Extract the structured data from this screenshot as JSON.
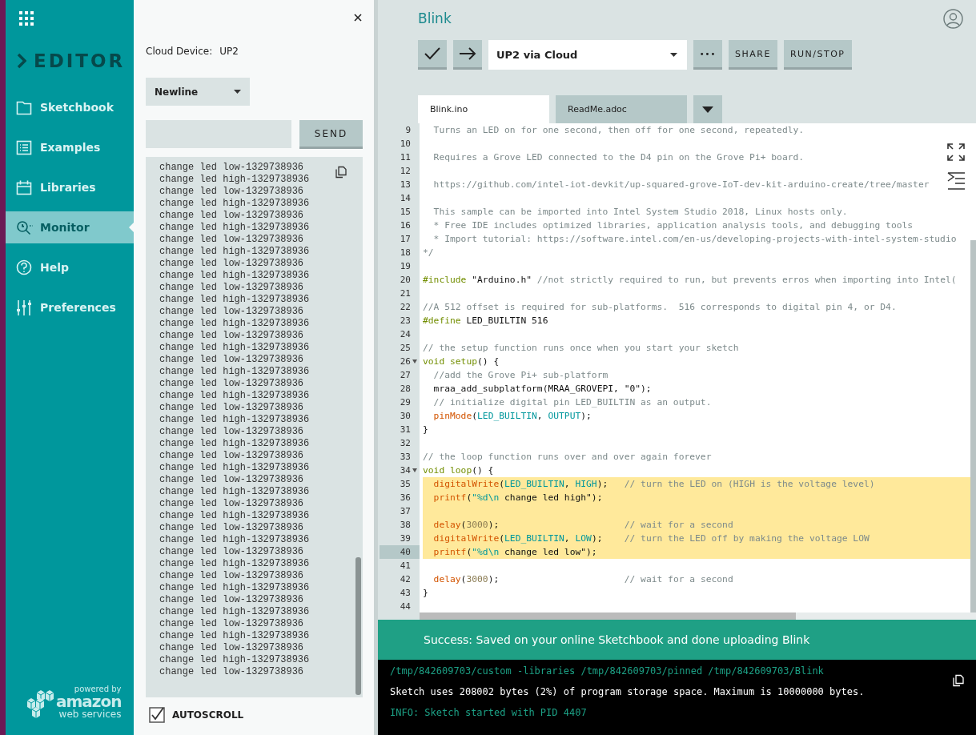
{
  "sidebar": {
    "logo": "EDITOR",
    "items": [
      {
        "label": "Sketchbook",
        "selected": false
      },
      {
        "label": "Examples",
        "selected": false
      },
      {
        "label": "Libraries",
        "selected": false
      },
      {
        "label": "Monitor",
        "selected": true
      },
      {
        "label": "Help",
        "selected": false
      },
      {
        "label": "Preferences",
        "selected": false
      }
    ],
    "footer": {
      "line_1": "powered by",
      "line_2": "amazon",
      "line_3": "web services"
    }
  },
  "monitor": {
    "device_label": "Cloud Device:",
    "device": "UP2",
    "line_ending": "Newline",
    "send_button": "SEND",
    "autoscroll": {
      "label": "AUTOSCROLL",
      "checked": true
    },
    "output": [
      "change led low-1329738936",
      "change led high-1329738936",
      "change led low-1329738936",
      "change led high-1329738936",
      "change led low-1329738936",
      "change led high-1329738936",
      "change led low-1329738936",
      "change led high-1329738936",
      "change led low-1329738936",
      "change led high-1329738936",
      "change led low-1329738936",
      "change led high-1329738936",
      "change led low-1329738936",
      "change led high-1329738936",
      "change led low-1329738936",
      "change led high-1329738936",
      "change led low-1329738936",
      "change led high-1329738936",
      "change led low-1329738936",
      "change led high-1329738936",
      "change led low-1329738936",
      "change led high-1329738936",
      "change led low-1329738936",
      "change led high-1329738936",
      "change led low-1329738936",
      "change led high-1329738936",
      "change led low-1329738936",
      "change led high-1329738936",
      "change led low-1329738936",
      "change led high-1329738936",
      "change led low-1329738936",
      "change led high-1329738936",
      "change led low-1329738936",
      "change led high-1329738936",
      "change led low-1329738936",
      "change led high-1329738936",
      "change led low-1329738936",
      "change led high-1329738936",
      "change led low-1329738936",
      "change led high-1329738936",
      "change led low-1329738936",
      "change led high-1329738936",
      "change led low-1329738936"
    ]
  },
  "header": {
    "title": "Blink",
    "board": "UP2 via Cloud",
    "buttons": [
      "SHARE",
      "RUN/STOP"
    ],
    "more": "•••"
  },
  "tabs": [
    {
      "label": "Blink.ino",
      "selected": true
    },
    {
      "label": "ReadMe.adoc",
      "selected": false
    }
  ],
  "code": [
    {
      "number": "9",
      "highlighted": false,
      "current": false,
      "foldable": false,
      "tokens": [
        {
          "kind": "comment",
          "text": "  Turns an LED on for one second, then off for one second, repeatedly."
        }
      ]
    },
    {
      "number": "10",
      "highlighted": false,
      "current": false,
      "foldable": false
    },
    {
      "number": "11",
      "highlighted": false,
      "current": false,
      "foldable": false,
      "tokens": [
        {
          "kind": "comment",
          "text": "  Requires a Grove LED connected to the D4 pin on the Grove Pi+ board."
        }
      ]
    },
    {
      "number": "12",
      "highlighted": false,
      "current": false,
      "foldable": false
    },
    {
      "number": "13",
      "highlighted": false,
      "current": false,
      "foldable": false,
      "tokens": [
        {
          "kind": "comment",
          "text": "  https://github.com/intel-iot-devkit/up-squared-grove-IoT-dev-kit-arduino-create/tree/master"
        }
      ]
    },
    {
      "number": "14",
      "highlighted": false,
      "current": false,
      "foldable": false
    },
    {
      "number": "15",
      "highlighted": false,
      "current": false,
      "foldable": false,
      "tokens": [
        {
          "kind": "comment",
          "text": "  This sample can be imported into Intel System Studio 2018, Linux hosts only."
        }
      ]
    },
    {
      "number": "16",
      "highlighted": false,
      "current": false,
      "foldable": false,
      "tokens": [
        {
          "kind": "comment",
          "text": "  * Free IDE includes optimized libraries, application analysis tools, and debugging tools"
        }
      ]
    },
    {
      "number": "17",
      "highlighted": false,
      "current": false,
      "foldable": false,
      "tokens": [
        {
          "kind": "comment",
          "text": "  * Import tutorial: https://software.intel.com/en-us/developing-projects-with-intel-system-studio"
        }
      ]
    },
    {
      "number": "18",
      "highlighted": false,
      "current": false,
      "foldable": false,
      "tokens": [
        {
          "kind": "comment",
          "text": "*/"
        }
      ]
    },
    {
      "number": "19",
      "highlighted": false,
      "current": false,
      "foldable": false
    },
    {
      "number": "20",
      "highlighted": false,
      "current": false,
      "foldable": false,
      "tokens": [
        {
          "kind": "keyword",
          "text": "#include"
        },
        {
          "kind": "plain",
          "text": " \"Arduino.h\""
        },
        {
          "kind": "comment",
          "text": " //not strictly required to run, but prevents erros when importing into Intel("
        }
      ]
    },
    {
      "number": "21",
      "highlighted": false,
      "current": false,
      "foldable": false
    },
    {
      "number": "22",
      "highlighted": false,
      "current": false,
      "foldable": false,
      "tokens": [
        {
          "kind": "comment",
          "text": "//A 512 offset is required for sub-platforms.  516 corresponds to digital pin 4, or D4."
        }
      ]
    },
    {
      "number": "23",
      "highlighted": false,
      "current": false,
      "foldable": false,
      "tokens": [
        {
          "kind": "keyword",
          "text": "#define"
        },
        {
          "kind": "plain",
          "text": " LED_BUILTIN 516"
        }
      ]
    },
    {
      "number": "24",
      "highlighted": false,
      "current": false,
      "foldable": false
    },
    {
      "number": "25",
      "highlighted": false,
      "current": false,
      "foldable": false,
      "tokens": [
        {
          "kind": "comment",
          "text": "// the setup function runs once when you start your sketch"
        }
      ]
    },
    {
      "number": "26",
      "highlighted": false,
      "current": false,
      "foldable": true,
      "tokens": [
        {
          "kind": "keyword",
          "text": "void setup"
        },
        {
          "kind": "plain",
          "text": "() {"
        }
      ]
    },
    {
      "number": "27",
      "highlighted": false,
      "current": false,
      "foldable": false,
      "tokens": [
        {
          "kind": "comment",
          "text": "  //add the Grove Pi+ sub-platform"
        }
      ]
    },
    {
      "number": "28",
      "highlighted": false,
      "current": false,
      "foldable": false,
      "tokens": [
        {
          "kind": "plain",
          "text": "  mraa_add_subplatform(MRAA_GROVEPI, \"0\");"
        }
      ]
    },
    {
      "number": "29",
      "highlighted": false,
      "current": false,
      "foldable": false,
      "tokens": [
        {
          "kind": "comment",
          "text": "  // initialize digital pin LED_BUILTIN as an output."
        }
      ]
    },
    {
      "number": "30",
      "highlighted": false,
      "current": false,
      "foldable": false,
      "tokens": [
        {
          "kind": "function",
          "text": "  pinMode"
        },
        {
          "kind": "plain",
          "text": "("
        },
        {
          "kind": "constant",
          "text": "LED_BUILTIN"
        },
        {
          "kind": "plain",
          "text": ", "
        },
        {
          "kind": "constant",
          "text": "OUTPUT"
        },
        {
          "kind": "plain",
          "text": ");"
        }
      ]
    },
    {
      "number": "31",
      "highlighted": false,
      "current": false,
      "foldable": false,
      "tokens": [
        {
          "kind": "plain",
          "text": "}"
        }
      ]
    },
    {
      "number": "32",
      "highlighted": false,
      "current": false,
      "foldable": false
    },
    {
      "number": "33",
      "highlighted": false,
      "current": false,
      "foldable": false,
      "tokens": [
        {
          "kind": "comment",
          "text": "// the loop function runs over and over again forever"
        }
      ]
    },
    {
      "number": "34",
      "highlighted": false,
      "current": false,
      "foldable": true,
      "tokens": [
        {
          "kind": "keyword",
          "text": "void loop"
        },
        {
          "kind": "plain",
          "text": "() {"
        }
      ]
    },
    {
      "number": "35",
      "highlighted": true,
      "current": false,
      "foldable": false,
      "tokens": [
        {
          "kind": "function",
          "text": "  digitalWrite"
        },
        {
          "kind": "plain",
          "text": "("
        },
        {
          "kind": "constant",
          "text": "LED_BUILTIN"
        },
        {
          "kind": "plain",
          "text": ", "
        },
        {
          "kind": "constant",
          "text": "HIGH"
        },
        {
          "kind": "plain",
          "text": ");   "
        },
        {
          "kind": "comment",
          "text": "// turn the LED on (HIGH is the voltage level)"
        }
      ]
    },
    {
      "number": "36",
      "highlighted": true,
      "current": false,
      "foldable": false,
      "tokens": [
        {
          "kind": "function",
          "text": "  printf"
        },
        {
          "kind": "plain",
          "text": "("
        },
        {
          "kind": "constant",
          "text": "\"%d\\n"
        },
        {
          "kind": "plain",
          "text": " change led high\");"
        }
      ]
    },
    {
      "number": "37",
      "highlighted": true,
      "current": false,
      "foldable": false
    },
    {
      "number": "38",
      "highlighted": true,
      "current": false,
      "foldable": false,
      "tokens": [
        {
          "kind": "function",
          "text": "  delay"
        },
        {
          "kind": "plain",
          "text": "("
        },
        {
          "kind": "number",
          "text": "3000"
        },
        {
          "kind": "plain",
          "text": ");                       "
        },
        {
          "kind": "comment",
          "text": "// wait for a second"
        }
      ]
    },
    {
      "number": "39",
      "highlighted": true,
      "current": false,
      "foldable": false,
      "tokens": [
        {
          "kind": "function",
          "text": "  digitalWrite"
        },
        {
          "kind": "plain",
          "text": "("
        },
        {
          "kind": "constant",
          "text": "LED_BUILTIN"
        },
        {
          "kind": "plain",
          "text": ", "
        },
        {
          "kind": "constant",
          "text": "LOW"
        },
        {
          "kind": "plain",
          "text": ");    "
        },
        {
          "kind": "comment",
          "text": "// turn the LED off by making the voltage LOW"
        }
      ]
    },
    {
      "number": "40",
      "highlighted": true,
      "current": true,
      "foldable": false,
      "tokens": [
        {
          "kind": "function",
          "text": "  printf"
        },
        {
          "kind": "plain",
          "text": "("
        },
        {
          "kind": "constant",
          "text": "\"%d\\n"
        },
        {
          "kind": "plain",
          "text": " change led low\");"
        }
      ]
    },
    {
      "number": "41",
      "highlighted": false,
      "current": false,
      "foldable": false
    },
    {
      "number": "42",
      "highlighted": false,
      "current": false,
      "foldable": false,
      "tokens": [
        {
          "kind": "function",
          "text": "  delay"
        },
        {
          "kind": "plain",
          "text": "("
        },
        {
          "kind": "number",
          "text": "3000"
        },
        {
          "kind": "plain",
          "text": ");                       "
        },
        {
          "kind": "comment",
          "text": "// wait for a second"
        }
      ]
    },
    {
      "number": "43",
      "highlighted": false,
      "current": false,
      "foldable": false,
      "tokens": [
        {
          "kind": "plain",
          "text": "}"
        }
      ]
    },
    {
      "number": "44",
      "highlighted": false,
      "current": false,
      "foldable": false
    }
  ],
  "notification": "Success: Saved on your online Sketchbook and done uploading Blink",
  "console": [
    {
      "kind": "info",
      "text": "/tmp/842609703/custom -libraries /tmp/842609703/pinned /tmp/842609703/Blink"
    },
    {
      "kind": "normal",
      "text": "Sketch uses 208002 bytes (2%) of program storage space. Maximum is 10000000 bytes."
    },
    {
      "kind": "info",
      "text": "INFO: Sketch started with PID 4407"
    }
  ]
}
